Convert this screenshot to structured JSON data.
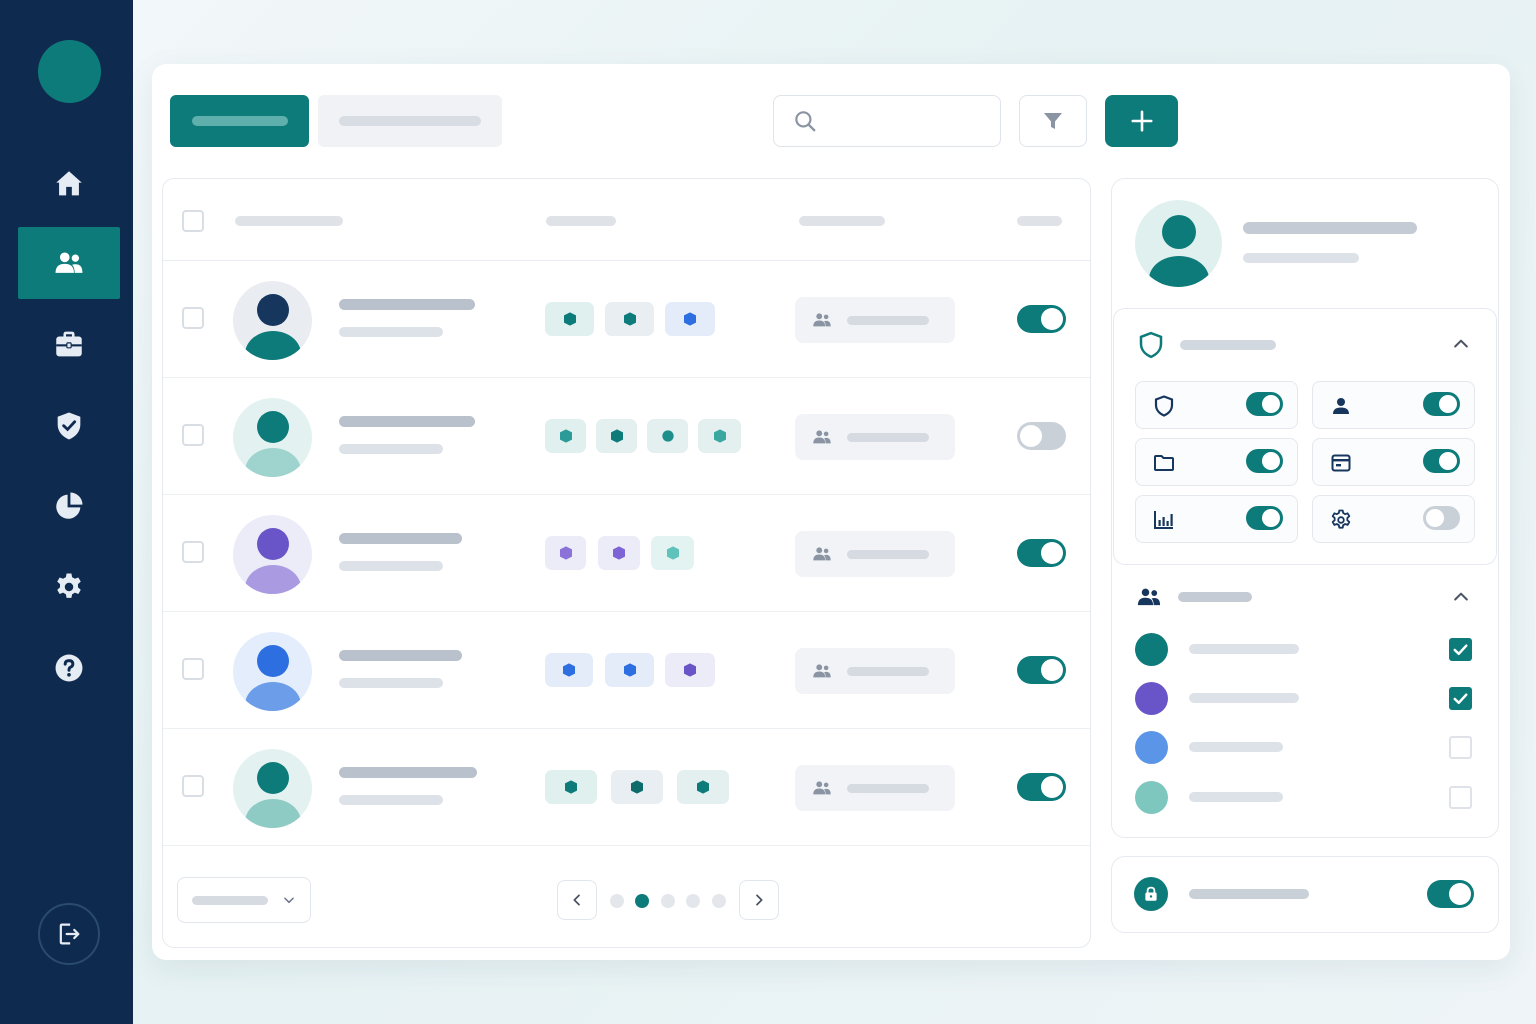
{
  "colors": {
    "sidebar": "#0f2a4f",
    "accent": "#0e7b7b",
    "purple": "#6a55c8",
    "blue": "#2d6fe0",
    "toggle_off": "#c9d0d8"
  },
  "sidebar": {
    "items": [
      {
        "icon": "home-icon",
        "active": false
      },
      {
        "icon": "users-icon",
        "active": true
      },
      {
        "icon": "briefcase-icon",
        "active": false
      },
      {
        "icon": "shield-check-icon",
        "active": false
      },
      {
        "icon": "pie-chart-icon",
        "active": false
      },
      {
        "icon": "gear-icon",
        "active": false
      },
      {
        "icon": "help-icon",
        "active": false
      }
    ],
    "logout_icon": "logout-icon"
  },
  "toolbar": {
    "tab_active_label": "",
    "tab_inactive_label": "",
    "search_placeholder": "",
    "filter_icon": "filter-icon",
    "add_icon": "plus-icon"
  },
  "table": {
    "rows": [
      {
        "avatar_color": "#17365e",
        "avatar_bg": "#e9ecf0",
        "body_color": "#0e7b7b",
        "badges": [
          "teal",
          "teal",
          "blue"
        ],
        "enabled": true
      },
      {
        "avatar_color": "#0e7b7b",
        "avatar_bg": "#e3f2f1",
        "body_color": "#9fd3ce",
        "badges": [
          "teal-light",
          "teal",
          "teal-light",
          "teal-light"
        ],
        "enabled": false
      },
      {
        "avatar_color": "#6a55c8",
        "avatar_bg": "#ecebf8",
        "body_color": "#a99ae2",
        "badges": [
          "purple",
          "purple",
          "teal-light"
        ],
        "enabled": true
      },
      {
        "avatar_color": "#2d6fe0",
        "avatar_bg": "#e4edfb",
        "body_color": "#6c9de9",
        "badges": [
          "blue",
          "blue",
          "purple"
        ],
        "enabled": true
      },
      {
        "avatar_color": "#0e7b7b",
        "avatar_bg": "#e3f2f1",
        "body_color": "#8fcbc5",
        "badges": [
          "teal",
          "teal",
          "teal"
        ],
        "enabled": true
      }
    ],
    "pagination": {
      "pages": 5,
      "current": 2
    }
  },
  "permissions": {
    "tiles": [
      {
        "icon": "shield-icon",
        "enabled": true
      },
      {
        "icon": "user-icon",
        "enabled": true
      },
      {
        "icon": "folder-icon",
        "enabled": true
      },
      {
        "icon": "calendar-card-icon",
        "enabled": true
      },
      {
        "icon": "bar-chart-icon",
        "enabled": true
      },
      {
        "icon": "gear-icon",
        "enabled": false
      }
    ]
  },
  "members": [
    {
      "color": "#0e7b7b",
      "checked": true
    },
    {
      "color": "#6a55c8",
      "checked": true
    },
    {
      "color": "#5b95e8",
      "checked": false
    },
    {
      "color": "#7ec7bf",
      "checked": false
    }
  ],
  "lock": {
    "icon": "lock-icon",
    "enabled": true
  }
}
